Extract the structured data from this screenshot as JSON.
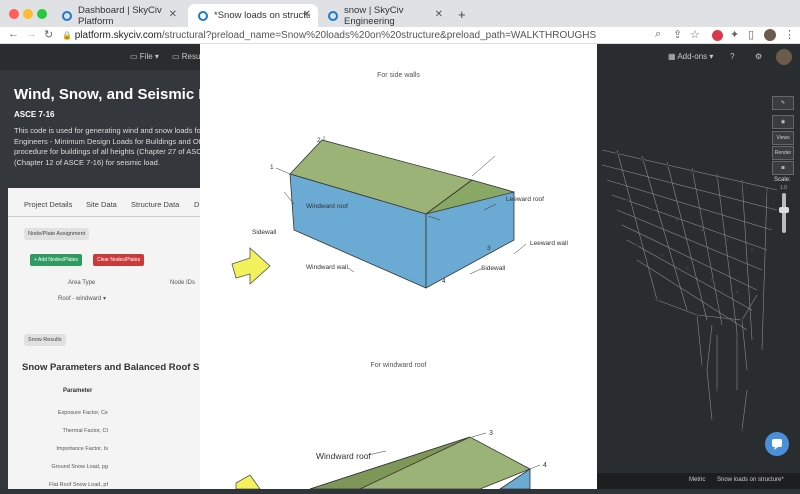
{
  "browser": {
    "tabs": [
      {
        "label": "Dashboard | SkyCiv Platform"
      },
      {
        "label": "*Snow loads on structure | Sk"
      },
      {
        "label": "snow | SkyCiv Engineering"
      }
    ],
    "new_tab": "+",
    "url_host": "platform.skyciv.com",
    "url_path": "/structural?preload_name=Snow%20loads%20on%20structure&preload_path=WALKTHROUGHS"
  },
  "appbar": {
    "file": "File",
    "result": "Result",
    "addons": "Add-ons"
  },
  "sidebar": {
    "title": "Wind, Snow, and Seismic Load G",
    "subtitle": "ASCE 7-16",
    "description": "This code is used for generating wind and snow loads fo Engineers - Minimum Design Loads for Buildings and Oth procedure for buildings of all heights (Chapter 27 of ASC (Chapter 12 of ASCE 7-16) for seismic load."
  },
  "panel": {
    "tabs": [
      "Project Details",
      "Site Data",
      "Structure Data",
      "D"
    ],
    "node_plate_badge": "Node/Plate Assignment",
    "add_button": "+ Add Nodes/Plates",
    "clear_button": "Clear Nodes/Plates",
    "area_type_label": "Area Type",
    "node_ids_label": "Node IDs",
    "area_type_value": "Roof - windward",
    "snow_results_badge": "Snow Results",
    "section_title": "Snow Parameters and Balanced Roof Sno",
    "param_header": "Parameter",
    "params": [
      "Exposure Factor, Ce",
      "Thermal Factor, Ct",
      "Importance Factor, Is",
      "Ground Snow Load, pg",
      "Flat Roof Snow Load, pf"
    ]
  },
  "modal": {
    "caption_top": "For side walls",
    "caption_bottom": "For windward roof",
    "diagram1": {
      "labels": [
        "1",
        "2",
        "3",
        "4",
        "Windward roof",
        "Sidewall",
        "Windward wall",
        "Sidewall",
        "Leeward roof",
        "Leeward wall"
      ]
    },
    "diagram2": {
      "labels": [
        "Windward roof",
        "3",
        "4"
      ]
    }
  },
  "right": {
    "tools": [
      "Views",
      "Render"
    ],
    "scale_label": "Scale:",
    "scale_value": "1.0",
    "footer_metric": "Metric",
    "footer_file": "Snow loads on structure*"
  },
  "colors": {
    "roof": "#9bb377",
    "wall": "#6aaad3",
    "arrow": "#f2f25c"
  }
}
